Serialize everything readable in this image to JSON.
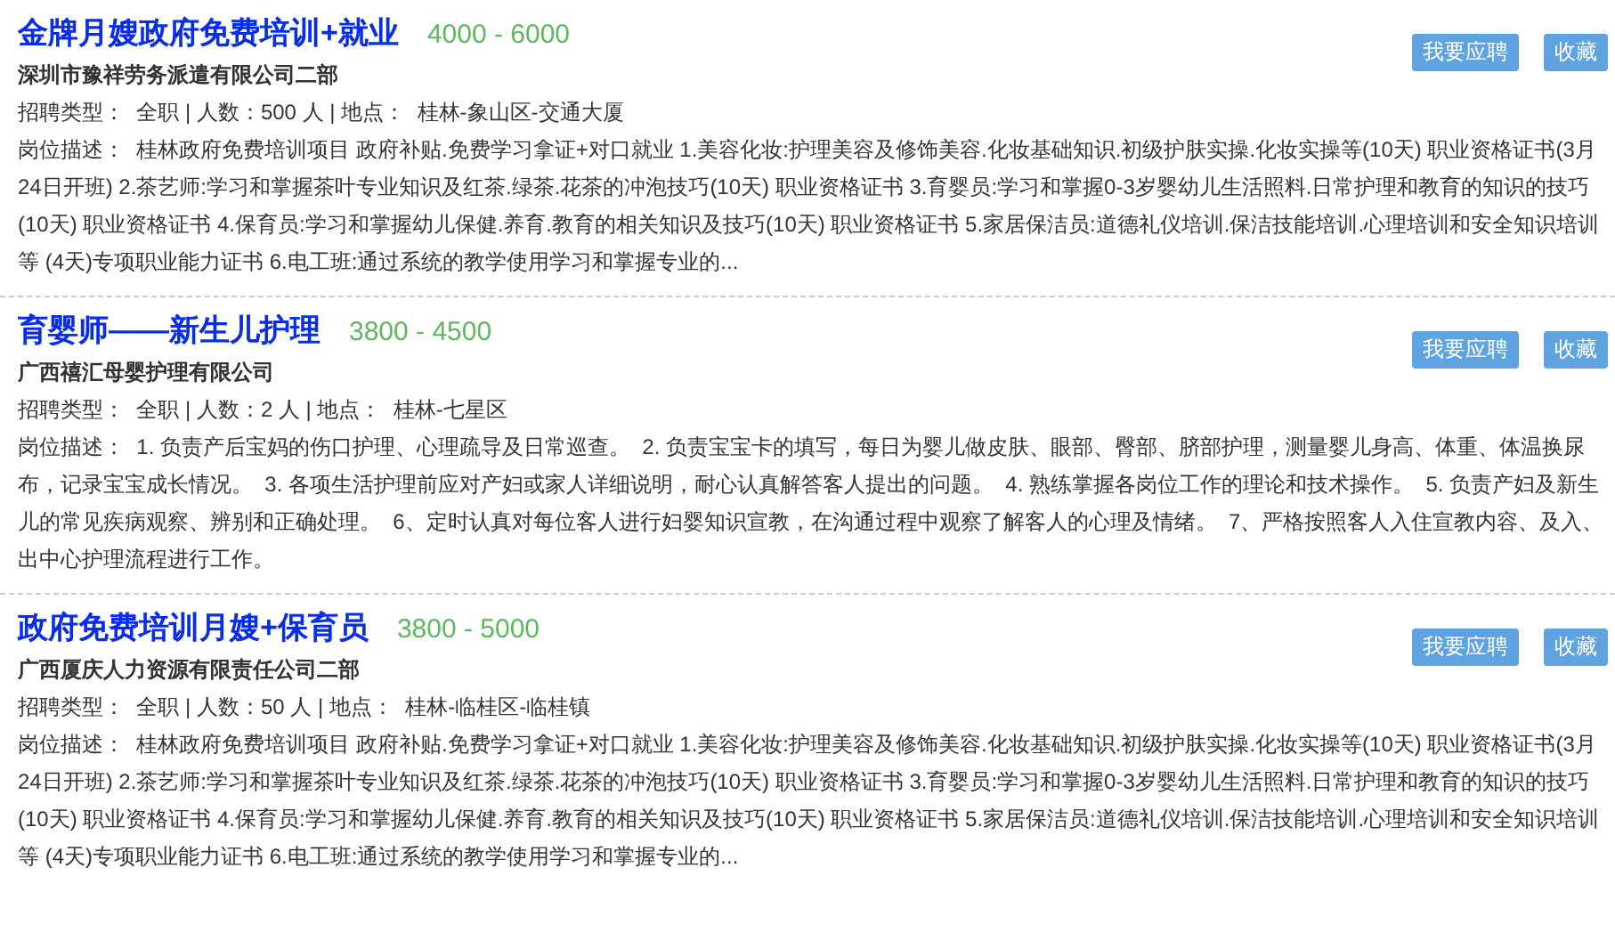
{
  "jobs": [
    {
      "title": "金牌月嫂政府免费培训+就业",
      "salary": "4000 - 6000",
      "company": "深圳市豫祥劳务派遣有限公司二部",
      "info": "招聘类型：  全职 | 人数：500 人 | 地点：  桂林-象山区-交通大厦",
      "description": "岗位描述：  桂林政府免费培训项目 政府补贴.免费学习拿证+对口就业 1.美容化妆:护理美容及修饰美容.化妆基础知识.初级护肤实操.化妆实操等(10天) 职业资格证书(3月24日开班) 2.茶艺师:学习和掌握茶叶专业知识及红茶.绿茶.花茶的冲泡技巧(10天) 职业资格证书 3.育婴员:学习和掌握0-3岁婴幼儿生活照料.日常护理和教育的知识的技巧(10天) 职业资格证书 4.保育员:学习和掌握幼儿保健.养育.教育的相关知识及技巧(10天) 职业资格证书 5.家居保洁员:道德礼仪培训.保洁技能培训.心理培训和安全知识培训等 (4天)专项职业能力证书 6.电工班:通过系统的教学使用学习和掌握专业的...",
      "buttons": [
        "我要应聘",
        "收藏"
      ]
    },
    {
      "title": "育婴师——新生儿护理",
      "salary": "3800 - 4500",
      "company": "广西禧汇母婴护理有限公司",
      "info": "招聘类型：  全职 | 人数：2 人 | 地点：  桂林-七星区",
      "description": "岗位描述：  1. 负责产后宝妈的伤口护理、心理疏导及日常巡查。  2. 负责宝宝卡的填写，每日为婴儿做皮肤、眼部、臀部、脐部护理，测量婴儿身高、体重、体温换尿布，记录宝宝成长情况。  3. 各项生活护理前应对产妇或家人详细说明，耐心认真解答客人提出的问题。  4. 熟练掌握各岗位工作的理论和技术操作。  5. 负责产妇及新生儿的常见疾病观察、辨别和正确处理。  6、定时认真对每位客人进行妇婴知识宣教，在沟通过程中观察了解客人的心理及情绪。  7、严格按照客人入住宣教内容、及入、出中心护理流程进行工作。",
      "buttons": [
        "我要应聘",
        "收藏"
      ]
    },
    {
      "title": "政府免费培训月嫂+保育员",
      "salary": "3800 - 5000",
      "company": "广西厦庆人力资源有限责任公司二部",
      "info": "招聘类型：  全职 | 人数：50 人 | 地点：  桂林-临桂区-临桂镇",
      "description": "岗位描述：  桂林政府免费培训项目 政府补贴.免费学习拿证+对口就业 1.美容化妆:护理美容及修饰美容.化妆基础知识.初级护肤实操.化妆实操等(10天) 职业资格证书(3月24日开班) 2.茶艺师:学习和掌握茶叶专业知识及红茶.绿茶.花茶的冲泡技巧(10天) 职业资格证书 3.育婴员:学习和掌握0-3岁婴幼儿生活照料.日常护理和教育的知识的技巧(10天) 职业资格证书 4.保育员:学习和掌握幼儿保健.养育.教育的相关知识及技巧(10天) 职业资格证书 5.家居保洁员:道德礼仪培训.保洁技能培训.心理培训和安全知识培训等 (4天)专项职业能力证书 6.电工班:通过系统的教学使用学习和掌握专业的...",
      "buttons": [
        "我要应聘",
        "收藏"
      ]
    }
  ]
}
